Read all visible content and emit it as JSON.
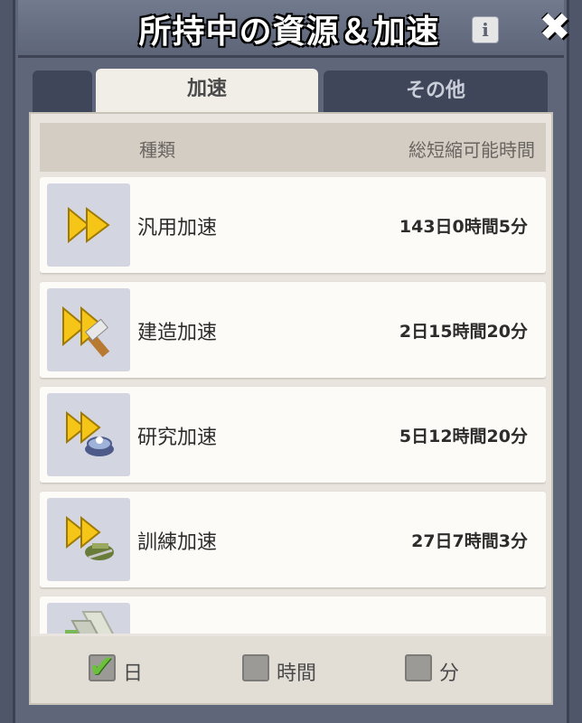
{
  "window": {
    "title": "所持中の資源＆加速"
  },
  "tabs": [
    {
      "label": ""
    },
    {
      "label": "加速",
      "active": true
    },
    {
      "label": "その他"
    }
  ],
  "list_header": {
    "type_label": "種類",
    "time_label": "総短縮可能時間"
  },
  "items": [
    {
      "name": "汎用加速",
      "time": "143日0時間5分",
      "icon": "universal-speedup-icon"
    },
    {
      "name": "建造加速",
      "time": "2日15時間20分",
      "icon": "construction-speedup-icon"
    },
    {
      "name": "研究加速",
      "time": "5日12時間20分",
      "icon": "research-speedup-icon"
    },
    {
      "name": "訓練加速",
      "time": "27日7時間3分",
      "icon": "training-speedup-icon"
    },
    {
      "name": "",
      "time": "",
      "icon": "healing-speedup-icon"
    }
  ],
  "filters": [
    {
      "label": "日",
      "checked": true
    },
    {
      "label": "時間",
      "checked": false
    },
    {
      "label": "分",
      "checked": false
    }
  ],
  "colors": {
    "accent_gold": "#f5c518",
    "check_green": "#6cc13c"
  }
}
